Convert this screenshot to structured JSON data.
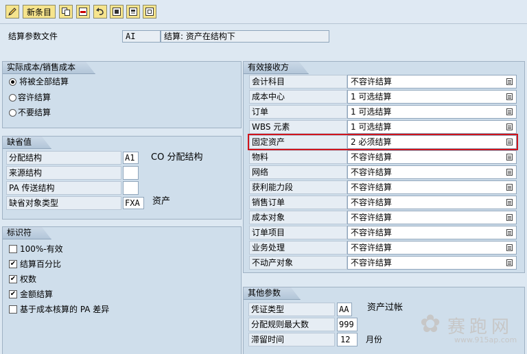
{
  "toolbar": {
    "new_entries_label": "新条目",
    "icons": [
      "edit-icon",
      "copy-icon",
      "delete-icon",
      "undo-icon",
      "select-all-icon",
      "select-block-icon",
      "deselect-all-icon"
    ]
  },
  "header": {
    "label": "结算参数文件",
    "code": "AI",
    "description": "结算: 资产在结构下"
  },
  "actual_cost": {
    "title": "实际成本/销售成本",
    "options": [
      {
        "label": "将被全部结算",
        "selected": true
      },
      {
        "label": "容许结算",
        "selected": false
      },
      {
        "label": "不要结算",
        "selected": false
      }
    ]
  },
  "defaults": {
    "title": "缺省值",
    "alloc_structure_label": "分配结构",
    "alloc_structure_value": "A1",
    "alloc_structure_desc": "CO 分配结构",
    "source_structure_label": "来源结构",
    "source_structure_value": "",
    "pa_transfer_label": "PA 传送结构",
    "pa_transfer_value": "",
    "default_object_type_label": "缺省对象类型",
    "default_object_type_value": "FXA",
    "default_object_type_desc": "资产"
  },
  "indicators": {
    "title": "标识符",
    "items": [
      {
        "label": "100%-有效",
        "checked": false
      },
      {
        "label": "结算百分比",
        "checked": true
      },
      {
        "label": "权数",
        "checked": true
      },
      {
        "label": "金额结算",
        "checked": true
      },
      {
        "label": "基于成本核算的 PA 差异",
        "checked": false
      }
    ]
  },
  "valid_receivers": {
    "title": "有效接收方",
    "rows": [
      {
        "label": "会计科目",
        "value": "不容许结算"
      },
      {
        "label": "成本中心",
        "value": "1 可选结算"
      },
      {
        "label": "订单",
        "value": "1 可选结算"
      },
      {
        "label": "WBS 元素",
        "value": "1 可选结算"
      },
      {
        "label": "固定资产",
        "value": "2 必须结算"
      },
      {
        "label": "物料",
        "value": "不容许结算"
      },
      {
        "label": "网络",
        "value": "不容许结算"
      },
      {
        "label": "获利能力段",
        "value": "不容许结算"
      },
      {
        "label": "销售订单",
        "value": "不容许结算"
      },
      {
        "label": "成本对象",
        "value": "不容许结算"
      },
      {
        "label": "订单项目",
        "value": "不容许结算"
      },
      {
        "label": "业务处理",
        "value": "不容许结算"
      },
      {
        "label": "不动产对象",
        "value": "不容许结算"
      }
    ]
  },
  "other_params": {
    "title": "其他参数",
    "doc_type_label": "凭证类型",
    "doc_type_value": "AA",
    "doc_type_desc": "资产过帐",
    "max_rules_label": "分配规则最大数",
    "max_rules_value": "999",
    "retention_label": "滞留时间",
    "retention_value": "12",
    "retention_unit": "月份"
  },
  "watermark": {
    "brand": "赛跑网",
    "url": "www.915ap.com"
  },
  "colors": {
    "highlight": "#d0141c",
    "background": "#dde8f2",
    "toolbar_button": "#f6e48c"
  }
}
